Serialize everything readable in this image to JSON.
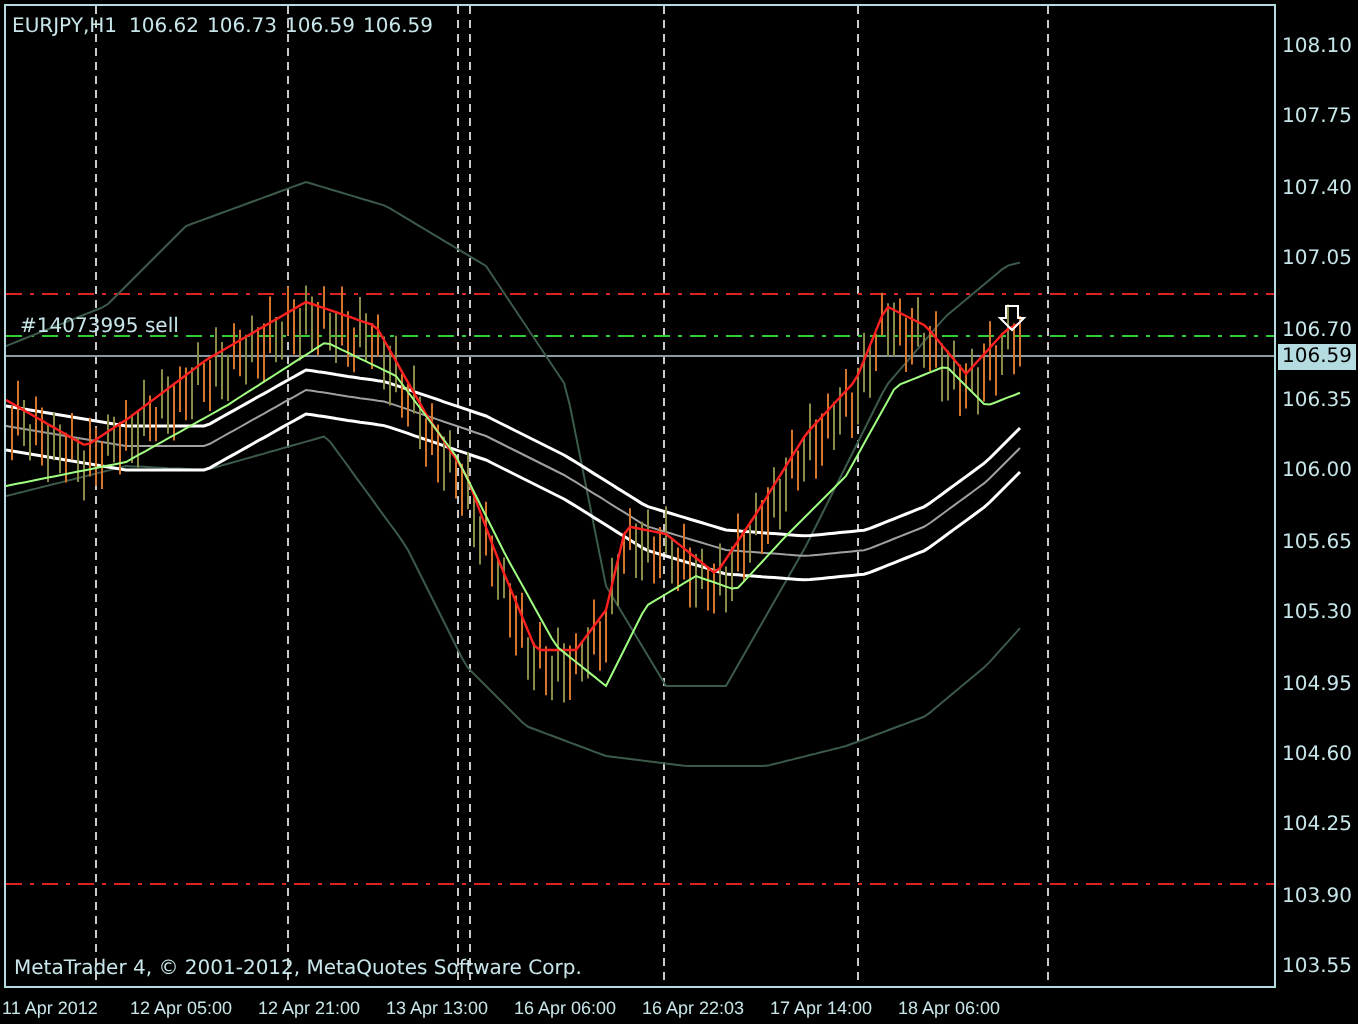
{
  "header": {
    "symbol": "EURJPY,H1",
    "quotes": [
      "106.62",
      "106.73",
      "106.59",
      "106.59"
    ]
  },
  "order_label": "#14073995 sell",
  "copyright": "MetaTrader 4, © 2001-2012, MetaQuotes Software Corp.",
  "price_axis": [
    "108.10",
    "107.75",
    "107.40",
    "107.05",
    "106.70",
    "106.35",
    "106.00",
    "105.65",
    "105.30",
    "104.95",
    "104.60",
    "104.25",
    "103.90",
    "103.55"
  ],
  "current_price": "106.59",
  "time_axis": [
    "11 Apr 2012",
    "12 Apr 05:00",
    "12 Apr 21:00",
    "13 Apr 13:00",
    "16 Apr 06:00",
    "16 Apr 22:03",
    "17 Apr 14:00",
    "18 Apr 06:00"
  ]
}
